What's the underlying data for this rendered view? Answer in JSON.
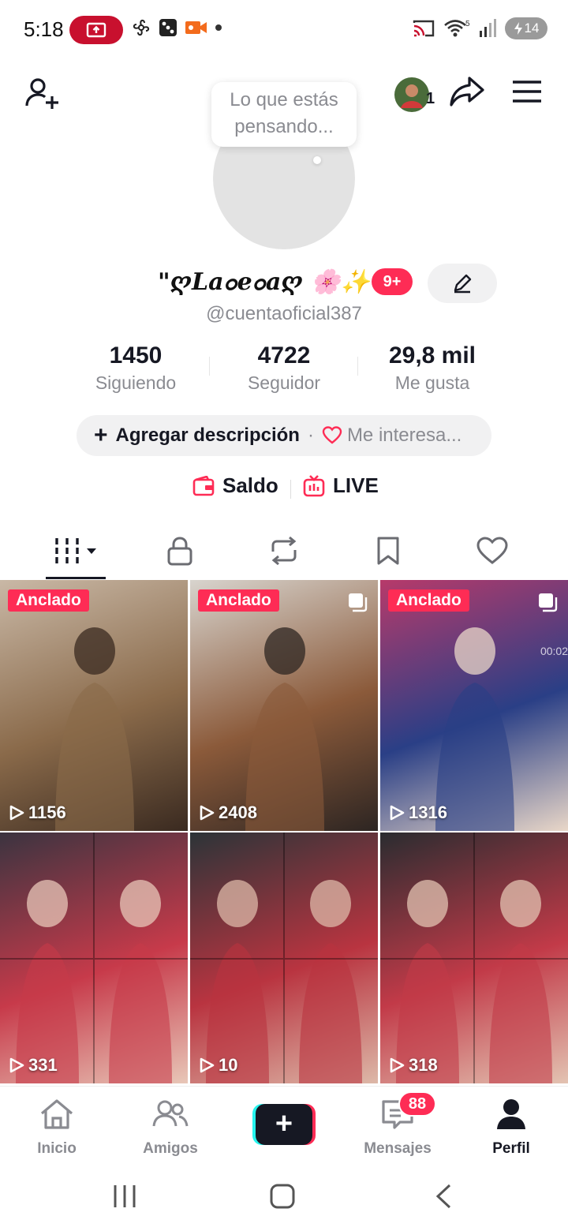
{
  "status_bar": {
    "time": "5:18",
    "battery": "14",
    "signal_label": "5"
  },
  "header": {
    "follower_count_mini": "1",
    "bubble_text": "Lo que estás pensando..."
  },
  "profile": {
    "display_name": "\"ღLaߋeߋaღ 🌸✨",
    "notifications_badge": "9+",
    "username": "@cuentaoficial387"
  },
  "stats": [
    {
      "value": "1450",
      "label": "Siguiendo"
    },
    {
      "value": "4722",
      "label": "Seguidor"
    },
    {
      "value": "29,8 mil",
      "label": "Me gusta"
    }
  ],
  "description": {
    "add_label": "Agregar descripción",
    "separator": "·",
    "interest_label": "Me interesa..."
  },
  "quick_links": {
    "balance": "Saldo",
    "live": "LIVE"
  },
  "videos": [
    {
      "pinned": "Anclado",
      "views": "1156",
      "multi": false,
      "colors": [
        "#c9b8a6",
        "#8a6a4a",
        "#3a2a20"
      ]
    },
    {
      "pinned": "Anclado",
      "views": "2408",
      "multi": true,
      "colors": [
        "#d8d4ce",
        "#8b5a3a",
        "#2d2522"
      ]
    },
    {
      "pinned": "Anclado",
      "views": "1316",
      "multi": true,
      "duration": "00:02",
      "colors": [
        "#b73a6a",
        "#2a3f86",
        "#e9d7c8"
      ]
    },
    {
      "pinned": "",
      "views": "331",
      "multi": false,
      "colors": [
        "#3b3440",
        "#c73a4a",
        "#e8c7b8"
      ]
    },
    {
      "pinned": "",
      "views": "10",
      "multi": false,
      "colors": [
        "#2c3438",
        "#b93440",
        "#ddb8a8"
      ]
    },
    {
      "pinned": "",
      "views": "318",
      "multi": false,
      "colors": [
        "#2a2c30",
        "#c23a48",
        "#e3c3b2"
      ]
    }
  ],
  "bottom_nav": {
    "home": "Inicio",
    "friends": "Amigos",
    "inbox": "Mensajes",
    "inbox_badge": "88",
    "profile": "Perfil"
  },
  "colors": {
    "accent": "#fe2c55",
    "cyan": "#25f4ee",
    "text": "#161823",
    "muted": "#8a8b91"
  }
}
